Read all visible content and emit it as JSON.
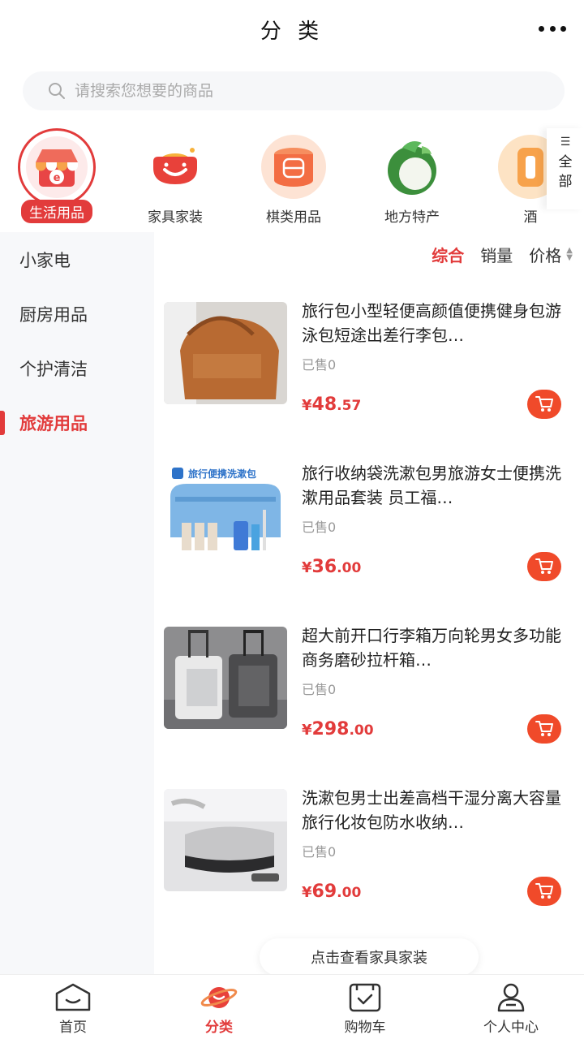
{
  "header": {
    "title": "分 类"
  },
  "search": {
    "placeholder": "请搜索您想要的商品"
  },
  "categories": [
    {
      "label": "生活用品",
      "icon": "shop-icon",
      "active": true
    },
    {
      "label": "家具家装",
      "icon": "sofa-icon"
    },
    {
      "label": "棋类用品",
      "icon": "chess-icon"
    },
    {
      "label": "地方特产",
      "icon": "coconut-icon"
    },
    {
      "label": "酒",
      "icon": "wine-icon"
    }
  ],
  "all_button": {
    "line1": "全",
    "line2": "部"
  },
  "side_nav": [
    {
      "label": "小家电"
    },
    {
      "label": "厨房用品"
    },
    {
      "label": "个护清洁"
    },
    {
      "label": "旅游用品",
      "active": true
    }
  ],
  "sort": {
    "comprehensive": "综合",
    "sales": "销量",
    "price": "价格"
  },
  "products": [
    {
      "name": "旅行包小型轻便高颜值便携健身包游泳包短途出差行李包…",
      "sold": "已售0",
      "currency": "¥",
      "price_int": "48",
      "price_dec": ".57"
    },
    {
      "name": "旅行收纳袋洗漱包男旅游女士便携洗漱用品套装 员工福…",
      "sold": "已售0",
      "currency": "¥",
      "price_int": "36",
      "price_dec": ".00",
      "image_caption": "旅行便携洗漱包"
    },
    {
      "name": "超大前开口行李箱万向轮男女多功能商务磨砂拉杆箱…",
      "sold": "已售0",
      "currency": "¥",
      "price_int": "298",
      "price_dec": ".00"
    },
    {
      "name": "洗漱包男士出差高档干湿分离大容量旅行化妆包防水收纳…",
      "sold": "已售0",
      "currency": "¥",
      "price_int": "69",
      "price_dec": ".00"
    }
  ],
  "tip": "点击查看家具家装",
  "tabs": [
    {
      "label": "首页",
      "icon": "home-icon"
    },
    {
      "label": "分类",
      "icon": "planet-icon",
      "active": true
    },
    {
      "label": "购物车",
      "icon": "cart-bag-icon"
    },
    {
      "label": "个人中心",
      "icon": "user-icon"
    }
  ],
  "colors": {
    "accent": "#e23b3b",
    "cart": "#f04a2a"
  }
}
